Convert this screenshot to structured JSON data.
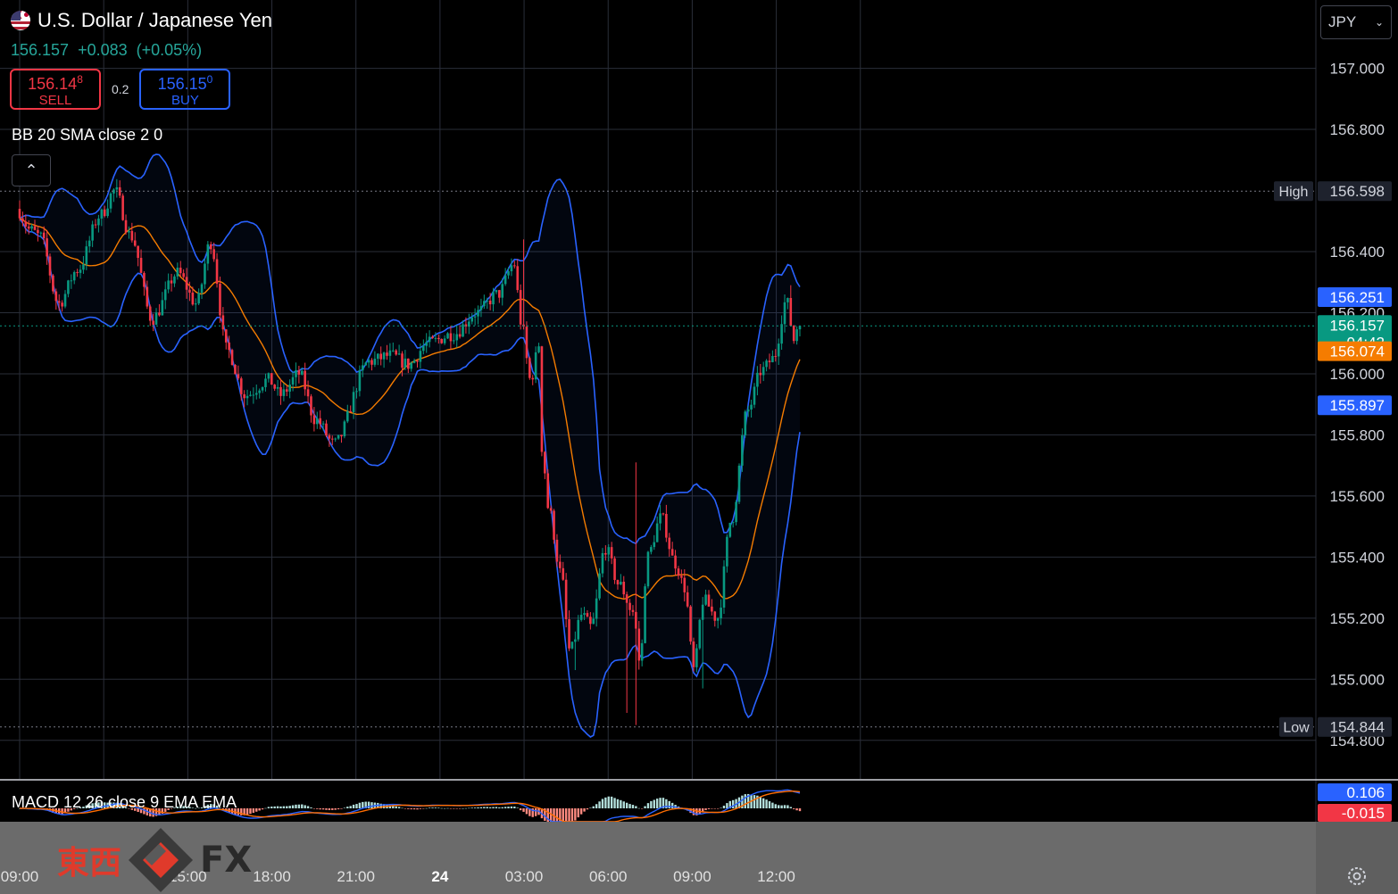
{
  "header": {
    "title": "U.S. Dollar / Japanese Yen",
    "last_price": "156.157",
    "change": "+0.083",
    "change_pct": "(+0.05%)",
    "sell_price": "156.14",
    "sell_price_sup": "8",
    "sell_label": "SELL",
    "buy_price": "156.15",
    "buy_price_sup": "0",
    "buy_label": "BUY",
    "spread": "0.2",
    "currency_option": "JPY"
  },
  "indicators": {
    "bb_label": "BB 20 SMA close 2 0",
    "macd_label": "MACD 12 26 close 9 EMA EMA"
  },
  "logo": {
    "kanji": "東西",
    "fx": "FX"
  },
  "chart_data": {
    "type": "candlestick",
    "title": "U.S. Dollar / Japanese Yen",
    "y_range": [
      154.7,
      157.25
    ],
    "y_ticks": [
      "157.000",
      "156.800",
      "156.400",
      "156.200",
      "156.000",
      "155.800",
      "155.600",
      "155.400",
      "155.200",
      "155.000",
      "154.800"
    ],
    "x_ticks": [
      "09:00",
      "15:00",
      "18:00",
      "21:00",
      "24",
      "03:00",
      "06:00",
      "09:00",
      "12:00"
    ],
    "x_tick_times": [
      0,
      360,
      540,
      720,
      900,
      1080,
      1260,
      1440,
      1620
    ],
    "time_range_minutes": [
      0,
      1680
    ],
    "candle_interval_minutes": 6.5,
    "grid": true,
    "high": {
      "label": "High",
      "value": "156.598"
    },
    "low": {
      "label": "Low",
      "value": "154.844"
    },
    "price_tags": [
      {
        "value": "156.251",
        "color": "#2962ff"
      },
      {
        "value": "156.157",
        "sub": "04:42",
        "color": "#089981"
      },
      {
        "value": "156.074",
        "color": "#f57c00"
      },
      {
        "value": "155.897",
        "color": "#2962ff"
      }
    ],
    "anchors": [
      {
        "t": 0,
        "p": 156.54
      },
      {
        "t": 30,
        "p": 156.47
      },
      {
        "t": 50,
        "p": 156.45
      },
      {
        "t": 90,
        "p": 156.23
      },
      {
        "t": 130,
        "p": 156.34
      },
      {
        "t": 180,
        "p": 156.52
      },
      {
        "t": 210,
        "p": 156.6
      },
      {
        "t": 245,
        "p": 156.45
      },
      {
        "t": 290,
        "p": 156.18
      },
      {
        "t": 345,
        "p": 156.33
      },
      {
        "t": 385,
        "p": 156.23
      },
      {
        "t": 415,
        "p": 156.43
      },
      {
        "t": 450,
        "p": 156.08
      },
      {
        "t": 490,
        "p": 155.93
      },
      {
        "t": 540,
        "p": 155.98
      },
      {
        "t": 565,
        "p": 155.93
      },
      {
        "t": 605,
        "p": 156.0
      },
      {
        "t": 640,
        "p": 155.85
      },
      {
        "t": 680,
        "p": 155.77
      },
      {
        "t": 755,
        "p": 156.04
      },
      {
        "t": 800,
        "p": 156.06
      },
      {
        "t": 840,
        "p": 156.03
      },
      {
        "t": 880,
        "p": 156.1
      },
      {
        "t": 935,
        "p": 156.13
      },
      {
        "t": 985,
        "p": 156.2
      },
      {
        "t": 1030,
        "p": 156.26
      },
      {
        "t": 1065,
        "p": 156.36
      },
      {
        "t": 1080,
        "p": 156.17
      },
      {
        "t": 1100,
        "p": 155.98
      },
      {
        "t": 1120,
        "p": 156.1
      },
      {
        "t": 1125,
        "p": 155.75
      },
      {
        "t": 1140,
        "p": 155.55
      },
      {
        "t": 1165,
        "p": 155.35
      },
      {
        "t": 1185,
        "p": 155.09
      },
      {
        "t": 1210,
        "p": 155.21
      },
      {
        "t": 1230,
        "p": 155.17
      },
      {
        "t": 1260,
        "p": 155.43
      },
      {
        "t": 1290,
        "p": 155.31
      },
      {
        "t": 1320,
        "p": 155.22
      },
      {
        "t": 1335,
        "p": 155.05
      },
      {
        "t": 1350,
        "p": 155.4
      },
      {
        "t": 1380,
        "p": 155.53
      },
      {
        "t": 1410,
        "p": 155.38
      },
      {
        "t": 1430,
        "p": 155.3
      },
      {
        "t": 1450,
        "p": 155.03
      },
      {
        "t": 1470,
        "p": 155.26
      },
      {
        "t": 1500,
        "p": 155.2
      },
      {
        "t": 1530,
        "p": 155.52
      },
      {
        "t": 1565,
        "p": 155.88
      },
      {
        "t": 1595,
        "p": 156.01
      },
      {
        "t": 1620,
        "p": 156.05
      },
      {
        "t": 1648,
        "p": 156.24
      },
      {
        "t": 1665,
        "p": 156.11
      },
      {
        "t": 1672,
        "p": 156.157
      }
    ],
    "bb": {
      "period": 20,
      "mult": 2
    },
    "macd": {
      "fast": 12,
      "slow": 26,
      "signal": 9,
      "last_macd": "0.106",
      "last_signal": "-0.015"
    },
    "colors": {
      "up": "#089981",
      "down": "#f23645",
      "bb_band": "#2962ff",
      "bb_basis": "#f57c00",
      "grid": "#2a2e39",
      "bg": "#000000"
    }
  }
}
